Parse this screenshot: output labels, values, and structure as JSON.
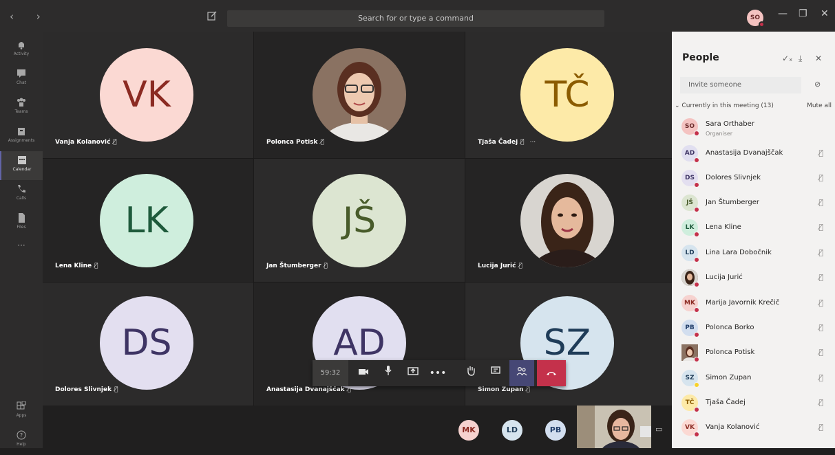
{
  "topbar": {
    "search_placeholder": "Search for or type a command",
    "me_initials": "SO"
  },
  "rail": [
    {
      "label": "Activity",
      "icon": "bell-icon"
    },
    {
      "label": "Chat",
      "icon": "chat-icon"
    },
    {
      "label": "Teams",
      "icon": "teams-icon"
    },
    {
      "label": "Assignments",
      "icon": "assignments-icon"
    },
    {
      "label": "Calendar",
      "icon": "calendar-icon",
      "active": true
    },
    {
      "label": "Calls",
      "icon": "phone-icon"
    },
    {
      "label": "Files",
      "icon": "files-icon"
    },
    {
      "label": "Apps",
      "icon": "apps-icon"
    },
    {
      "label": "Help",
      "icon": "help-icon"
    }
  ],
  "tiles": [
    {
      "name": "Vanja Kolanović",
      "initials": "VK",
      "bg": "#fbd9d3",
      "fg": "#8b2a22"
    },
    {
      "name": "Polonca Potisk",
      "photo": true
    },
    {
      "name": "Tjaša Čadej",
      "initials": "TČ",
      "bg": "#fdeaa8",
      "fg": "#8b5b00"
    },
    {
      "name": "Lena Kline",
      "initials": "LK",
      "bg": "#cfeedd",
      "fg": "#1e5a3b"
    },
    {
      "name": "Jan Štumberger",
      "initials": "JŠ",
      "bg": "#dce5d1",
      "fg": "#485b2a"
    },
    {
      "name": "Lucija Jurić",
      "photo": true
    },
    {
      "name": "Dolores Slivnjek",
      "initials": "DS",
      "bg": "#e3dff0",
      "fg": "#3e3464"
    },
    {
      "name": "Anastasija Dvanajščak",
      "initials": "AD",
      "bg": "#e1dff0",
      "fg": "#3e3464"
    },
    {
      "name": "Simon Zupan",
      "initials": "SZ",
      "bg": "#d6e4ee",
      "fg": "#1f3c58"
    }
  ],
  "controls": {
    "timer": "59:32"
  },
  "overflow_avatars": [
    {
      "initials": "MK",
      "bg": "#f6d2cf",
      "fg": "#8b2a22"
    },
    {
      "initials": "LD",
      "bg": "#d6e4ee",
      "fg": "#1f3c58"
    },
    {
      "initials": "PB",
      "bg": "#d2deef",
      "fg": "#1f3c68"
    }
  ],
  "people_panel": {
    "title": "People",
    "invite_placeholder": "Invite someone",
    "section_label": "Currently in this meeting (13)",
    "mute_all": "Mute all",
    "people": [
      {
        "initials": "SO",
        "name": "Sara Orthaber",
        "role": "Organiser",
        "bg": "#f4c3c1",
        "fg": "#6b2b2b"
      },
      {
        "initials": "AD",
        "name": "Anastasija Dvanajščak",
        "bg": "#e1dff0",
        "fg": "#3e3464"
      },
      {
        "initials": "DS",
        "name": "Dolores Slivnjek",
        "bg": "#e3dff0",
        "fg": "#3e3464"
      },
      {
        "initials": "JŠ",
        "name": "Jan Štumberger",
        "bg": "#dce5d1",
        "fg": "#485b2a"
      },
      {
        "initials": "LK",
        "name": "Lena Kline",
        "bg": "#cfeedd",
        "fg": "#1e5a3b"
      },
      {
        "initials": "LD",
        "name": "Lina Lara Dobočnik",
        "bg": "#d6e4ee",
        "fg": "#1f3c58"
      },
      {
        "initials": "",
        "name": "Lucija Jurić",
        "photo": true
      },
      {
        "initials": "MK",
        "name": "Marija Javornik Krečič",
        "bg": "#f6d2cf",
        "fg": "#8b2a22"
      },
      {
        "initials": "PB",
        "name": "Polonca Borko",
        "bg": "#d2deef",
        "fg": "#1f3c68"
      },
      {
        "initials": "",
        "name": "Polonca Potisk",
        "photo": true
      },
      {
        "initials": "SZ",
        "name": "Simon Zupan",
        "bg": "#d6e4ee",
        "fg": "#1f3c58",
        "away": true
      },
      {
        "initials": "TČ",
        "name": "Tjaša Čadej",
        "bg": "#fdeaa8",
        "fg": "#8b5b00"
      },
      {
        "initials": "VK",
        "name": "Vanja Kolanović",
        "bg": "#fbd9d3",
        "fg": "#8b2a22"
      }
    ]
  }
}
